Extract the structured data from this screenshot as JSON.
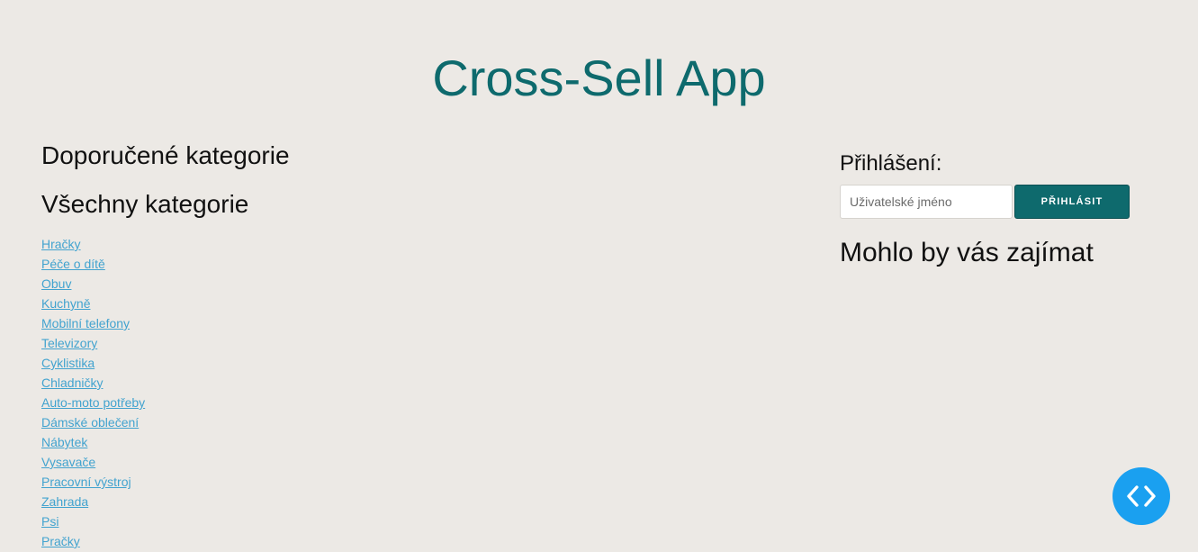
{
  "app": {
    "title": "Cross-Sell App"
  },
  "left": {
    "recommended_heading": "Doporučené kategorie",
    "all_heading": "Všechny kategorie",
    "categories": [
      "Hračky",
      "Péče o dítě",
      "Obuv",
      "Kuchyně",
      "Mobilní telefony",
      "Televizory",
      "Cyklistika",
      "Chladničky",
      "Auto-moto potřeby",
      "Dámské oblečení",
      "Nábytek",
      "Vysavače",
      "Pracovní výstroj",
      "Zahrada",
      "Psi",
      "Pračky"
    ]
  },
  "login": {
    "label": "Přihlášení:",
    "username_placeholder": "Uživatelské jméno",
    "username_value": "",
    "button_label": "PŘIHLÁSIT"
  },
  "suggestions": {
    "heading": "Mohlo by vás zajímat"
  },
  "fab": {
    "icon": "code-icon"
  },
  "colors": {
    "background": "#ece9e5",
    "accent": "#0e6a6d",
    "link": "#42a3cf",
    "fab": "#1aa0f0"
  }
}
